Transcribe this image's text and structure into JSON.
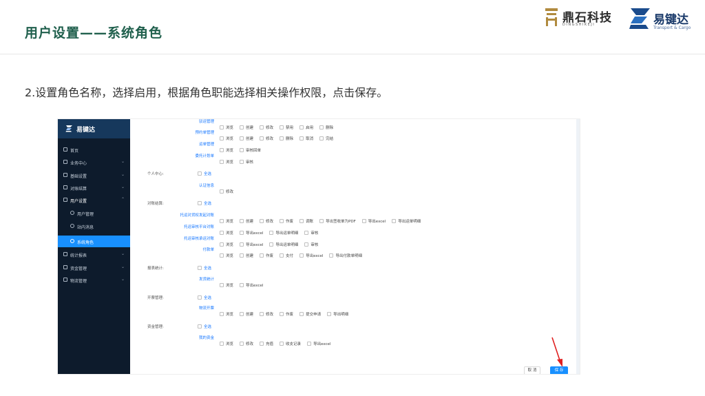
{
  "slide": {
    "title": "用户设置——系统角色",
    "instruction": "2.设置角色名称，选择启用，根据角色职能选择相关操作权限，点击保存。",
    "logo_left": {
      "name": "鼎石科技",
      "sub": "DINGSHIKEJI"
    },
    "logo_right": {
      "name": "易键达",
      "sub": "Transport & Cargo"
    }
  },
  "app": {
    "brand": "易键达",
    "sidebar": [
      {
        "label": "首页",
        "icon": "home-icon",
        "chevron": ""
      },
      {
        "label": "业务中心",
        "icon": "folder-icon",
        "chevron": "⌄"
      },
      {
        "label": "基础设置",
        "icon": "gear-icon",
        "chevron": "⌄"
      },
      {
        "label": "对账结算",
        "icon": "calculator-icon",
        "chevron": "⌄"
      },
      {
        "label": "用户设置",
        "icon": "user-settings-icon",
        "chevron": "⌃"
      },
      {
        "label": "用户管理",
        "icon": "user-icon",
        "chevron": ""
      },
      {
        "label": "站内消息",
        "icon": "message-icon",
        "chevron": ""
      },
      {
        "label": "系统角色",
        "icon": "role-icon",
        "chevron": ""
      },
      {
        "label": "统计报表",
        "icon": "report-icon",
        "chevron": "⌄"
      },
      {
        "label": "资金管理",
        "icon": "wallet-icon",
        "chevron": "⌄"
      },
      {
        "label": "物流管理",
        "icon": "truck-icon",
        "chevron": "⌄"
      }
    ],
    "sections": [
      {
        "name": "个人中心:",
        "all": "全选"
      },
      {
        "name": "对账结算:",
        "all": "全选"
      },
      {
        "name": "报表统计:",
        "all": "全选"
      },
      {
        "name": "开票管理:",
        "all": "全选"
      },
      {
        "name": "资金管理:",
        "all": "全选"
      }
    ],
    "rows": [
      {
        "label": "驳运管理",
        "options": [
          "浏览",
          "创建",
          "修改",
          "禁用",
          "启用",
          "删除"
        ]
      },
      {
        "label": "预约单管理",
        "options": [
          "浏览",
          "创建",
          "修改",
          "删除",
          "取消",
          "完结"
        ]
      },
      {
        "label": "运单管理",
        "options": [
          "浏览",
          "审核回单"
        ]
      },
      {
        "label": "委托计划单",
        "options": [
          "浏览",
          "审核"
        ]
      },
      {
        "label": "认证信息",
        "options": [
          "修改"
        ]
      },
      {
        "label": "托运对货权发起对账",
        "options": [
          "浏览",
          "创建",
          "修改",
          "作废",
          "调账",
          "导出签收单为PDF",
          "导出excel",
          "导出运单明细"
        ]
      },
      {
        "label": "托运审核平台对账",
        "options": [
          "浏览",
          "导出excel",
          "导出运单明细",
          "审核"
        ]
      },
      {
        "label": "托运审核承运对账",
        "options": [
          "浏览",
          "导出excel",
          "导出运单明细",
          "审核"
        ]
      },
      {
        "label": "付款单",
        "options": [
          "浏览",
          "创建",
          "作废",
          "支付",
          "导出excel",
          "导出付款单明细"
        ]
      },
      {
        "label": "发货统计",
        "options": [
          "浏览",
          "导出excel"
        ]
      },
      {
        "label": "物流开票",
        "options": [
          "浏览",
          "创建",
          "修改",
          "作废",
          "提交申请",
          "导出明细"
        ]
      },
      {
        "label": "我的资金",
        "options": [
          "浏览",
          "修改",
          "充值",
          "收支记录",
          "导出excel"
        ]
      }
    ],
    "buttons": {
      "cancel": "取 消",
      "save": "保 存"
    }
  }
}
